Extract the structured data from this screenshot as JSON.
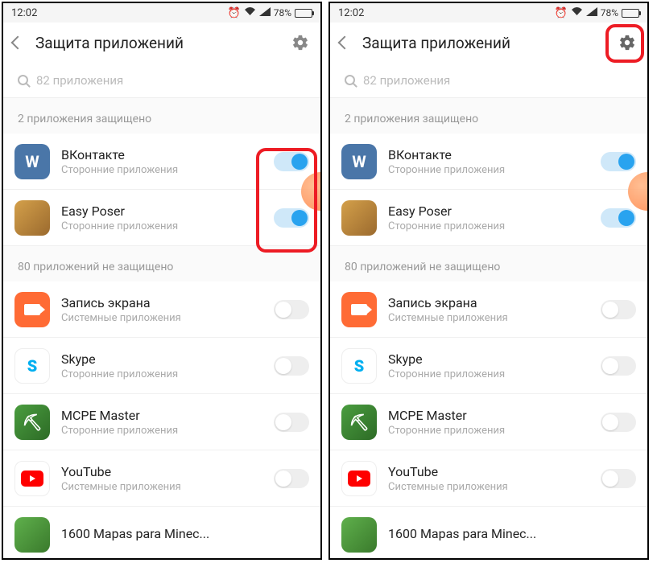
{
  "status": {
    "time": "12:02",
    "battery_pct": "78%"
  },
  "header": {
    "title": "Защита приложений"
  },
  "search": {
    "placeholder": "82 приложения"
  },
  "sections": {
    "protected_label": "2 приложения защищено",
    "unprotected_label": "80 приложений не защищено"
  },
  "categories": {
    "third_party": "Сторонние приложения",
    "system": "Системные приложения"
  },
  "apps": {
    "vk": {
      "name": "ВКонтакте"
    },
    "easy": {
      "name": "Easy Poser"
    },
    "rec": {
      "name": "Запись экрана"
    },
    "skype": {
      "name": "Skype"
    },
    "mcpe": {
      "name": "MCPE Master"
    },
    "yt": {
      "name": "YouTube"
    },
    "mapas": {
      "name": "1600 Mapas para Minec..."
    }
  }
}
